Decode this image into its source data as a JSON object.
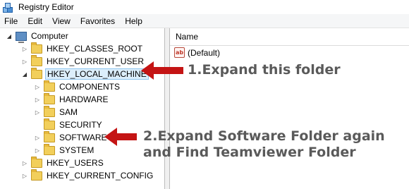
{
  "window": {
    "title": "Registry Editor"
  },
  "menu": [
    "File",
    "Edit",
    "View",
    "Favorites",
    "Help"
  ],
  "tree": {
    "root": "Computer",
    "nodes": [
      "HKEY_CLASSES_ROOT",
      "HKEY_CURRENT_USER",
      "HKEY_LOCAL_MACHINE",
      "COMPONENTS",
      "HARDWARE",
      "SAM",
      "SECURITY",
      "SOFTWARE",
      "SYSTEM",
      "HKEY_USERS",
      "HKEY_CURRENT_CONFIG"
    ]
  },
  "list": {
    "column_name": "Name",
    "values": [
      "(Default)"
    ]
  },
  "annotations": {
    "step1": "1.Expand this folder",
    "step2_line1": "2.Expand Software Folder again",
    "step2_line2": "and Find Teamviewer Folder",
    "color": "#c41414"
  }
}
